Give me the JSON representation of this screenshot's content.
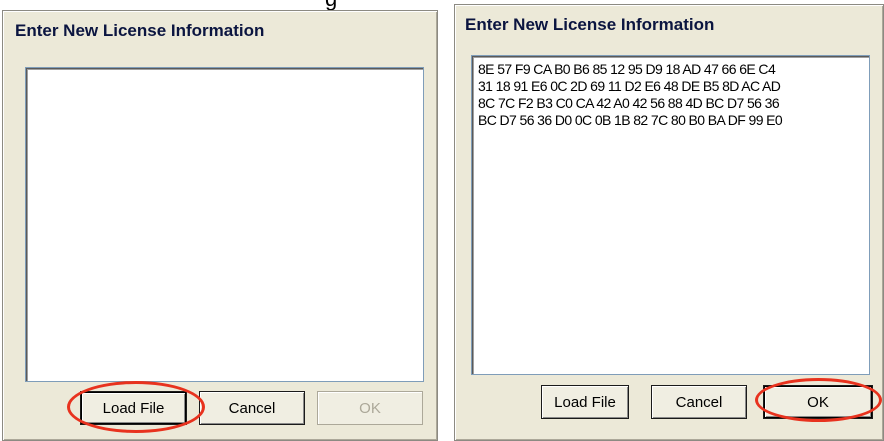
{
  "left_dialog": {
    "title": "Enter New License Information",
    "license_text": [],
    "buttons": {
      "load_file": "Load File",
      "cancel": "Cancel",
      "ok": "OK"
    },
    "ok_enabled": false
  },
  "right_dialog": {
    "title": "Enter New License Information",
    "license_text": [
      "8E 57 F9 CA B0 B6 85 12 95 D9 18 AD 47 66 6E C4",
      "31 18 91 E6 0C 2D 69 11 D2 E6 48 DE B5 8D AC AD",
      "8C 7C F2 B3 C0 CA 42 A0 42 56 88 4D BC D7 56 36",
      "BC D7 56 36 D0 0C 0B 1B 82 7C 80 B0 BA DF 99 E0"
    ],
    "buttons": {
      "load_file": "Load File",
      "cancel": "Cancel",
      "ok": "OK"
    },
    "ok_enabled": true
  },
  "highlights": {
    "color": "#e8321e",
    "circled": [
      "left_dialog.load_file",
      "right_dialog.ok"
    ]
  },
  "cropped_caption": "g"
}
